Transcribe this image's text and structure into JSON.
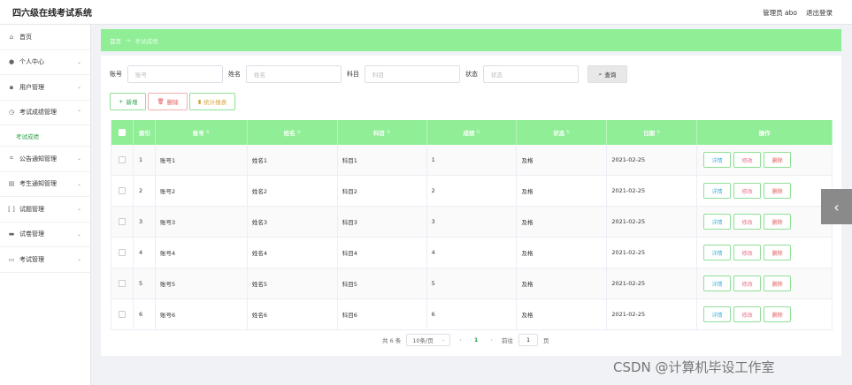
{
  "header": {
    "title": "四六级在线考试系统",
    "admin_label": "管理员 abo",
    "logout": "退出登录"
  },
  "sidebar": {
    "items": [
      {
        "label": "首页",
        "icon": "home-icon",
        "glyph": "⌂",
        "has_chevron": false
      },
      {
        "label": "个人中心",
        "icon": "user-icon",
        "glyph": "●",
        "has_chevron": true
      },
      {
        "label": "用户管理",
        "icon": "users-icon",
        "glyph": "▪",
        "has_chevron": true
      },
      {
        "label": "考试成绩管理",
        "icon": "clock-icon",
        "glyph": "◷",
        "has_chevron": true,
        "expanded": true
      },
      {
        "label": "公告通知管理",
        "icon": "crop-icon",
        "glyph": "⌗",
        "has_chevron": true
      },
      {
        "label": "考生通知管理",
        "icon": "document-icon",
        "glyph": "▤",
        "has_chevron": true
      },
      {
        "label": "试题管理",
        "icon": "brackets-icon",
        "glyph": "[ ]",
        "has_chevron": true
      },
      {
        "label": "试卷管理",
        "icon": "paper-icon",
        "glyph": "▬",
        "has_chevron": true
      },
      {
        "label": "考试管理",
        "icon": "monitor-icon",
        "glyph": "▭",
        "has_chevron": true
      }
    ],
    "subitem": "考试成绩"
  },
  "breadcrumb": {
    "home": "首页",
    "separator": "→",
    "current": "考试成绩"
  },
  "search": {
    "fields": [
      {
        "label": "账号",
        "placeholder": "账号"
      },
      {
        "label": "姓名",
        "placeholder": "姓名"
      },
      {
        "label": "科目",
        "placeholder": "科目"
      },
      {
        "label": "状态",
        "placeholder": "状态"
      }
    ],
    "button": "查询"
  },
  "actions": {
    "add": "新增",
    "delete": "删除",
    "report": "统计报表"
  },
  "table": {
    "columns": [
      "索引",
      "账号",
      "姓名",
      "科目",
      "成绩",
      "状态",
      "日期",
      "操作"
    ],
    "rows": [
      {
        "index": "1",
        "account": "账号1",
        "name": "姓名1",
        "subject": "科目1",
        "score": "1",
        "status": "及格",
        "date": "2021-02-25"
      },
      {
        "index": "2",
        "account": "账号2",
        "name": "姓名2",
        "subject": "科目2",
        "score": "2",
        "status": "及格",
        "date": "2021-02-25"
      },
      {
        "index": "3",
        "account": "账号3",
        "name": "姓名3",
        "subject": "科目3",
        "score": "3",
        "status": "及格",
        "date": "2021-02-25"
      },
      {
        "index": "4",
        "account": "账号4",
        "name": "姓名4",
        "subject": "科目4",
        "score": "4",
        "status": "及格",
        "date": "2021-02-25"
      },
      {
        "index": "5",
        "account": "账号5",
        "name": "姓名5",
        "subject": "科目5",
        "score": "5",
        "status": "及格",
        "date": "2021-02-25"
      },
      {
        "index": "6",
        "account": "账号6",
        "name": "姓名6",
        "subject": "科目6",
        "score": "6",
        "status": "及格",
        "date": "2021-02-25"
      }
    ],
    "row_actions": {
      "detail": "详情",
      "edit": "修改",
      "delete": "删除"
    }
  },
  "pagination": {
    "total": "共 6 条",
    "page_size": "10条/页",
    "prev": "‹",
    "current_page": "1",
    "next": "›",
    "goto_label": "前往",
    "goto_value": "1",
    "goto_suffix": "页"
  },
  "watermark": "CSDN @计算机毕设工作室",
  "colors": {
    "accent": "#8fee96",
    "active_text": "#29a046",
    "danger": "#e05a5a"
  }
}
